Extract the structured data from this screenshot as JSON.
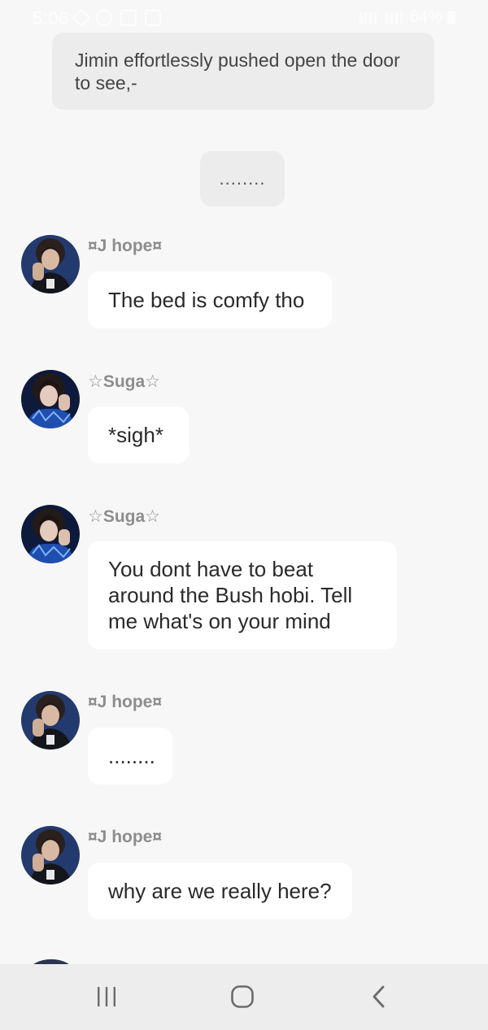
{
  "status_bar": {
    "time": "5:06",
    "battery_percent": "64%"
  },
  "narration": {
    "text": "Jimin effortlessly pushed open the door to see,-"
  },
  "center_bubble": {
    "text": "........"
  },
  "messages": [
    {
      "sender": "¤J hope¤",
      "avatar": "jhope-avatar",
      "text": "The bed is comfy tho"
    },
    {
      "sender": "☆Suga☆",
      "avatar": "suga-avatar",
      "text": "*sigh*"
    },
    {
      "sender": "☆Suga☆",
      "avatar": "suga-avatar",
      "text": "You dont have to beat around the Bush hobi. Tell me what's on your mind"
    },
    {
      "sender": "¤J hope¤",
      "avatar": "jhope-avatar",
      "text": "........"
    },
    {
      "sender": "¤J hope¤",
      "avatar": "jhope-avatar",
      "text": "why are we really here?"
    }
  ],
  "navbar": {
    "icons": [
      "recent-apps-icon",
      "home-icon",
      "back-icon"
    ]
  },
  "colors": {
    "background": "#f7f7f7",
    "bubble": "#ffffff",
    "narration_bubble": "#ececec",
    "sender_name": "#8d8d8d",
    "navbar": "#ededed"
  }
}
